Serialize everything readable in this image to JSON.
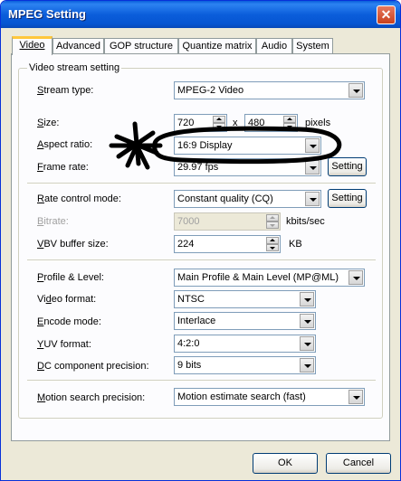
{
  "window": {
    "title": "MPEG Setting",
    "close_glyph": "✕"
  },
  "tabs": [
    {
      "label": "Video",
      "active": true
    },
    {
      "label": "Advanced"
    },
    {
      "label": "GOP structure"
    },
    {
      "label": "Quantize matrix"
    },
    {
      "label": "Audio"
    },
    {
      "label": "System"
    }
  ],
  "group": {
    "title": "Video stream setting"
  },
  "stream_type": {
    "label_u": "S",
    "label_rest": "tream type:",
    "value": "MPEG-2 Video"
  },
  "size": {
    "label_u": "S",
    "label_rest": "ize:",
    "width": "720",
    "times": "x",
    "height": "480",
    "unit": "pixels"
  },
  "aspect_ratio": {
    "label_u": "A",
    "label_rest": "spect ratio:",
    "value": "16:9 Display"
  },
  "frame_rate": {
    "label_u": "F",
    "label_rest": "rame rate:",
    "value": "29.97 fps",
    "button": "Setting"
  },
  "rate_control": {
    "label_u": "R",
    "label_rest": "ate control mode:",
    "value": "Constant quality (CQ)",
    "button": "Setting"
  },
  "bitrate": {
    "label_u": "B",
    "label_rest": "itrate:",
    "value": "7000",
    "unit": "kbits/sec",
    "disabled": true
  },
  "vbv": {
    "label_u": "V",
    "label_rest": "BV buffer size:",
    "value": "224",
    "unit": "KB"
  },
  "profile_level": {
    "label_u": "P",
    "label_rest": "rofile & Level:",
    "value": "Main Profile & Main Level (MP@ML)"
  },
  "video_format": {
    "label_pre": "Vi",
    "label_u": "d",
    "label_rest": "eo format:",
    "value": "NTSC"
  },
  "encode_mode": {
    "label_u": "E",
    "label_rest": "ncode mode:",
    "value": "Interlace"
  },
  "yuv_format": {
    "label_u": "Y",
    "label_rest": "UV format:",
    "value": "4:2:0"
  },
  "dc_precision": {
    "label_u": "D",
    "label_rest": "C component precision:",
    "value": "9 bits"
  },
  "motion_search": {
    "label_u": "M",
    "label_rest": "otion search precision:",
    "value": "Motion estimate search (fast)"
  },
  "footer": {
    "ok": "OK",
    "cancel": "Cancel"
  },
  "colors": {
    "title_bar": "#0A5FDB",
    "tab_highlight": "#FFC73C",
    "scribble": "#000000"
  }
}
